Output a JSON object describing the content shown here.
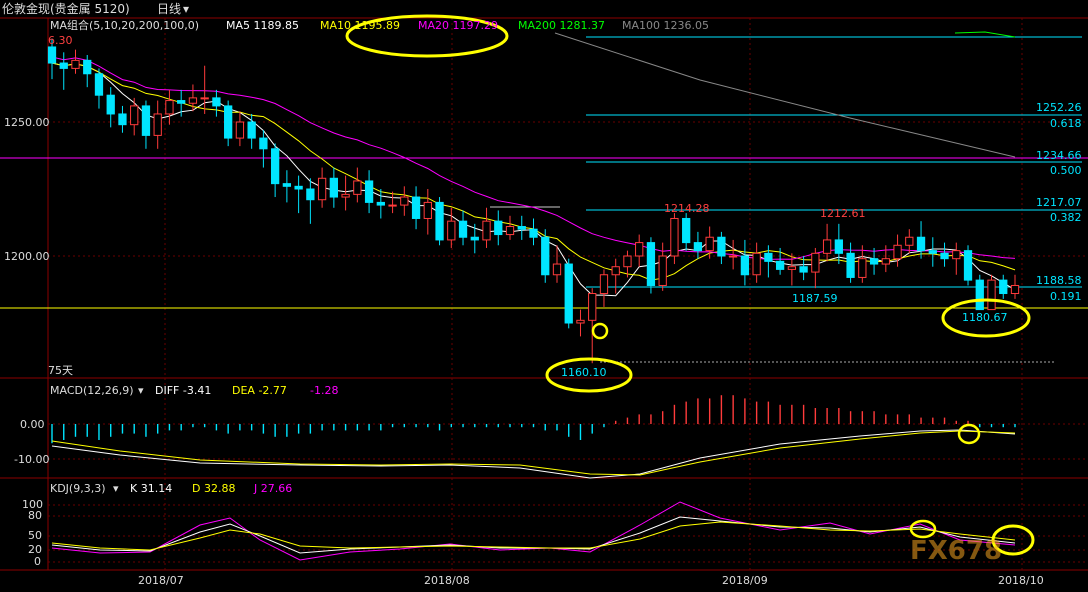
{
  "header": {
    "instrument": "伦敦金现(贵金属 5120)",
    "period": "日线",
    "period_arrow": "▾"
  },
  "ma_legend": {
    "name": "MA组合(5,10,20,200,100,0)",
    "items": [
      {
        "label": "MA5 1189.85",
        "color": "#ffffff"
      },
      {
        "label": "MA10 1195.89",
        "color": "#ffff00"
      },
      {
        "label": "MA20 1197.29",
        "color": "#ff00ff"
      },
      {
        "label": "MA200 1281.37",
        "color": "#00ff00"
      },
      {
        "label": "MA100 1236.05",
        "color": "#888888"
      }
    ],
    "top_left_value": "6.30"
  },
  "price_axis": {
    "labels": [
      "1250.00",
      "1200.00"
    ]
  },
  "fib_levels": [
    {
      "price": "1252.26",
      "ratio": "0.618"
    },
    {
      "price": "1234.66",
      "ratio": "0.500"
    },
    {
      "price": "1217.07",
      "ratio": "0.382"
    },
    {
      "price": "1188.58",
      "ratio": "0.191"
    }
  ],
  "price_annotations": {
    "high1": "1214.28",
    "high2": "1212.61",
    "low_mid": "1187.59",
    "low_main": "1160.10",
    "low_right": "1180.67",
    "days_label": "75天"
  },
  "macd": {
    "name": "MACD(12,26,9)",
    "diff": "DIFF -3.41",
    "dea": "DEA -2.77",
    "macd_value": "-1.28",
    "axis": [
      "0.00",
      "-10.00"
    ]
  },
  "kdj": {
    "name": "KDJ(9,3,3)",
    "k": "K 31.14",
    "d": "D 32.88",
    "j": "J 27.66",
    "axis": [
      "100",
      "80",
      "50",
      "20",
      "0"
    ]
  },
  "time_axis": [
    "2018/07",
    "2018/08",
    "2018/09",
    "2018/10"
  ],
  "watermark": "FX678",
  "colors": {
    "up": "#ff3b3b",
    "down": "#00e5ff",
    "highlight": "#ffff00",
    "fib": "#00e5ff"
  },
  "chart_data": {
    "type": "candlestick",
    "ylim": [
      1150,
      1300
    ],
    "candles": [
      [
        1278,
        1272,
        1281,
        1266
      ],
      [
        1272,
        1270,
        1276,
        1262
      ],
      [
        1270,
        1273,
        1277,
        1268
      ],
      [
        1273,
        1268,
        1275,
        1263
      ],
      [
        1268,
        1260,
        1270,
        1255
      ],
      [
        1260,
        1253,
        1263,
        1248
      ],
      [
        1253,
        1249,
        1256,
        1246
      ],
      [
        1249,
        1256,
        1259,
        1245
      ],
      [
        1256,
        1245,
        1258,
        1240
      ],
      [
        1245,
        1253,
        1258,
        1240
      ],
      [
        1253,
        1258,
        1262,
        1249
      ],
      [
        1258,
        1257,
        1262,
        1252
      ],
      [
        1257,
        1259,
        1264,
        1254
      ],
      [
        1259,
        1259,
        1271,
        1253
      ],
      [
        1259,
        1256,
        1262,
        1252
      ],
      [
        1256,
        1244,
        1258,
        1241
      ],
      [
        1244,
        1250,
        1254,
        1241
      ],
      [
        1250,
        1244,
        1253,
        1240
      ],
      [
        1244,
        1240,
        1247,
        1233
      ],
      [
        1240,
        1227,
        1242,
        1222
      ],
      [
        1227,
        1226,
        1232,
        1220
      ],
      [
        1226,
        1225,
        1230,
        1216
      ],
      [
        1225,
        1221,
        1229,
        1212
      ],
      [
        1221,
        1229,
        1233,
        1218
      ],
      [
        1229,
        1222,
        1233,
        1218
      ],
      [
        1222,
        1223,
        1230,
        1217
      ],
      [
        1223,
        1228,
        1233,
        1220
      ],
      [
        1228,
        1220,
        1232,
        1216
      ],
      [
        1220,
        1219,
        1225,
        1214
      ],
      [
        1219,
        1219,
        1224,
        1216
      ],
      [
        1219,
        1222,
        1226,
        1215
      ],
      [
        1222,
        1214,
        1226,
        1210
      ],
      [
        1214,
        1220,
        1225,
        1208
      ],
      [
        1220,
        1206,
        1222,
        1204
      ],
      [
        1206,
        1213,
        1218,
        1203
      ],
      [
        1213,
        1207,
        1217,
        1204
      ],
      [
        1207,
        1206,
        1212,
        1201
      ],
      [
        1206,
        1213,
        1218,
        1203
      ],
      [
        1213,
        1208,
        1217,
        1204
      ],
      [
        1208,
        1211,
        1215,
        1206
      ],
      [
        1211,
        1210,
        1215,
        1206
      ],
      [
        1210,
        1207,
        1214,
        1204
      ],
      [
        1207,
        1193,
        1210,
        1190
      ],
      [
        1193,
        1197,
        1204,
        1190
      ],
      [
        1197,
        1175,
        1199,
        1173
      ],
      [
        1175,
        1176,
        1180,
        1170
      ],
      [
        1176,
        1186,
        1188,
        1160
      ],
      [
        1186,
        1193,
        1195,
        1181
      ],
      [
        1193,
        1196,
        1199,
        1186
      ],
      [
        1196,
        1200,
        1202,
        1192
      ],
      [
        1200,
        1205,
        1208,
        1196
      ],
      [
        1205,
        1189,
        1207,
        1186
      ],
      [
        1189,
        1200,
        1205,
        1187
      ],
      [
        1200,
        1214,
        1216,
        1197
      ],
      [
        1214,
        1205,
        1216,
        1202
      ],
      [
        1205,
        1202,
        1209,
        1199
      ],
      [
        1202,
        1207,
        1211,
        1199
      ],
      [
        1207,
        1200,
        1209,
        1197
      ],
      [
        1200,
        1200,
        1206,
        1195
      ],
      [
        1200,
        1193,
        1206,
        1189
      ],
      [
        1193,
        1201,
        1205,
        1190
      ],
      [
        1201,
        1198,
        1204,
        1192
      ],
      [
        1198,
        1195,
        1203,
        1193
      ],
      [
        1195,
        1196,
        1201,
        1189
      ],
      [
        1196,
        1194,
        1200,
        1191
      ],
      [
        1194,
        1201,
        1203,
        1188
      ],
      [
        1201,
        1206,
        1212,
        1198
      ],
      [
        1206,
        1201,
        1212,
        1197
      ],
      [
        1201,
        1192,
        1205,
        1190
      ],
      [
        1192,
        1199,
        1204,
        1190
      ],
      [
        1199,
        1197,
        1203,
        1193
      ],
      [
        1197,
        1199,
        1204,
        1194
      ],
      [
        1199,
        1204,
        1208,
        1196
      ],
      [
        1204,
        1207,
        1210,
        1201
      ],
      [
        1207,
        1202,
        1213,
        1199
      ],
      [
        1202,
        1201,
        1207,
        1196
      ],
      [
        1201,
        1199,
        1205,
        1196
      ],
      [
        1199,
        1202,
        1205,
        1193
      ],
      [
        1202,
        1191,
        1204,
        1189
      ],
      [
        1191,
        1180,
        1193,
        1180
      ],
      [
        1180,
        1191,
        1193,
        1180
      ],
      [
        1191,
        1186,
        1193,
        1184
      ],
      [
        1186,
        1189,
        1193,
        1184
      ]
    ]
  }
}
